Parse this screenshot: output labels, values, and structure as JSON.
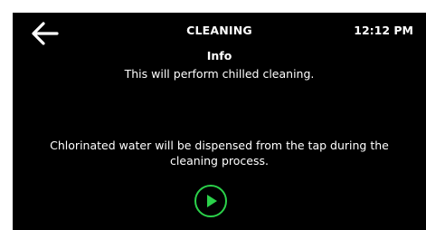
{
  "header": {
    "back_icon": "arrow-left-icon",
    "title": "CLEANING",
    "time": "12:12 PM"
  },
  "info": {
    "heading": "Info",
    "message": "This will perform chilled cleaning."
  },
  "warning": {
    "message": "Chlorinated water will be dispensed from the tap during the cleaning process."
  },
  "actions": {
    "start_icon": "play-icon",
    "accent_color": "#2bd14a"
  }
}
